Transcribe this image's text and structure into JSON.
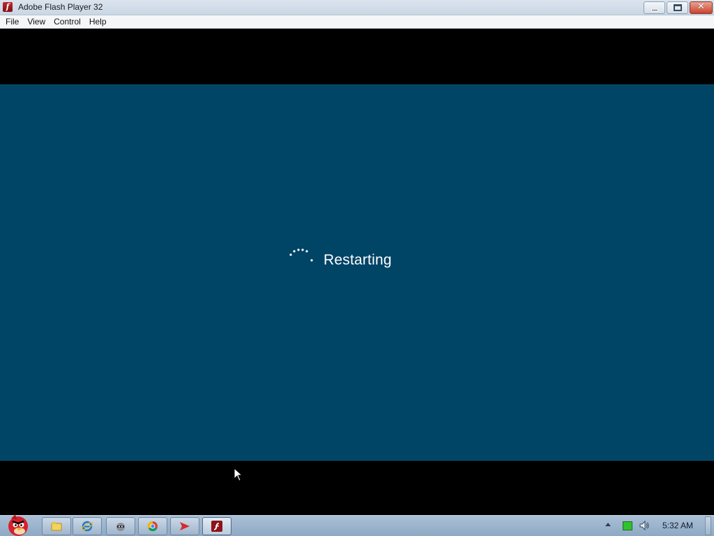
{
  "window": {
    "title": "Adobe Flash Player 32",
    "icon": "flash-player-icon",
    "controls": [
      "minimize",
      "restore",
      "close"
    ],
    "close_glyph": "✕"
  },
  "menubar": {
    "items": [
      "File",
      "View",
      "Control",
      "Help"
    ]
  },
  "screen": {
    "background": "#004466",
    "message": "Restarting",
    "spinner_icon": "loading-dots-icon"
  },
  "taskbar": {
    "start_icon": "angry-birds-start-icon",
    "pinned": [
      {
        "name": "windows-explorer",
        "icon": "folder-icon"
      },
      {
        "name": "internet-explorer",
        "icon": "internet-explorer-icon"
      },
      {
        "name": "raccoon-app",
        "icon": "raccoon-icon"
      },
      {
        "name": "chrome",
        "icon": "chrome-icon"
      },
      {
        "name": "send-app",
        "icon": "paper-plane-icon"
      },
      {
        "name": "flash-player",
        "icon": "flash-player-icon",
        "active": true
      }
    ],
    "clock": "5:32 AM"
  }
}
